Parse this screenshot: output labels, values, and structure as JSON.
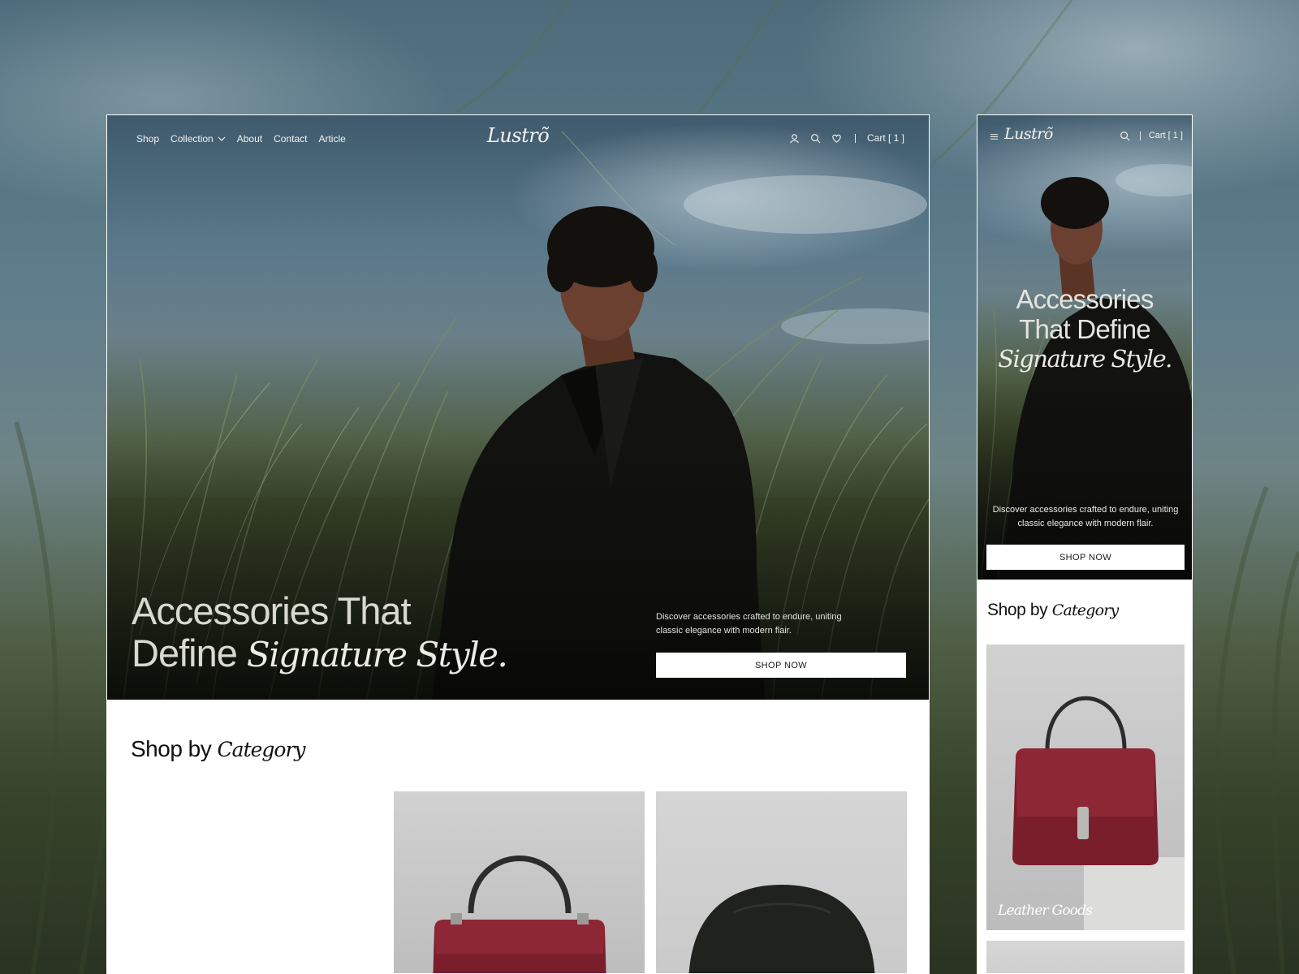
{
  "brand": {
    "logo": "Lustrõ"
  },
  "desktop": {
    "nav": {
      "links": [
        "Shop",
        "Collection",
        "About",
        "Contact",
        "Article"
      ],
      "cart": "Cart [ 1 ]"
    },
    "hero": {
      "headline_line1": "Accessories That",
      "headline_line2_plain": "Define ",
      "headline_line2_italic": "Signature Style.",
      "description": "Discover accessories crafted to endure, uniting classic elegance with modern flair.",
      "cta": "SHOP NOW"
    },
    "category": {
      "title_plain": "Shop by ",
      "title_italic": "Category"
    }
  },
  "mobile": {
    "nav": {
      "cart": "Cart [ 1 ]"
    },
    "hero": {
      "headline_line1": "Accessories",
      "headline_line2": "That Define",
      "headline_line3_italic": "Signature Style.",
      "description": "Discover accessories crafted to endure, uniting classic elegance with modern flair.",
      "cta": "SHOP NOW"
    },
    "category": {
      "title_plain": "Shop by ",
      "title_italic": "Category",
      "cards": [
        {
          "label": "Leather Goods"
        }
      ]
    }
  },
  "icons": {
    "nav": [
      "user-icon",
      "search-icon",
      "heart-icon"
    ],
    "collection_dropdown": "chevron-down-icon",
    "mobile_menu": "hamburger-menu-icon"
  },
  "colors": {
    "hero_sky": "#5a788a",
    "grass": "#3f4b2b",
    "bag": "#7a1e2c",
    "button_bg": "#ffffff",
    "text_dark": "#111111"
  }
}
